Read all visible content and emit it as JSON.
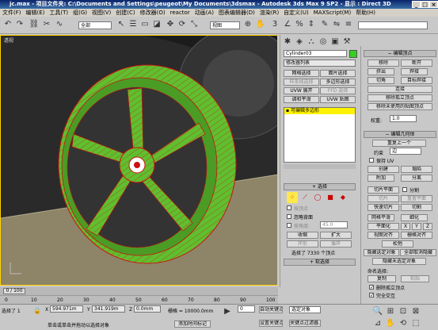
{
  "title": {
    "file": "jc.max",
    "project": "- 项目文件夹: C:\\Documents and Settings\\peugeot\\My Documents\\3dsmax",
    "app": "- Autodesk 3ds Max 9 SP2",
    "display": "- 显示 : Direct 3D"
  },
  "menu": [
    "文件(F)",
    "编辑(E)",
    "工具(T)",
    "组(G)",
    "视图(V)",
    "创建(C)",
    "修改器(O)",
    "reactor",
    "动画(A)",
    "图表编辑器(D)",
    "渲染(R)",
    "自定义(U)",
    "MAXScript(M)",
    "帮助(H)"
  ],
  "toolbar": {
    "selection_filter": "全部",
    "ref_coord": "视图"
  },
  "viewport": {
    "label": "透视",
    "bg_color": "#2a2a2a",
    "object_color": "#5fbf2f",
    "edge_color": "#cc1010"
  },
  "timeline": {
    "frame": "0 / 100",
    "ticks": [
      "0",
      "10",
      "20",
      "30",
      "40",
      "50",
      "60",
      "70",
      "80",
      "90",
      "100"
    ]
  },
  "status": {
    "selected": "选择了 1",
    "x": "594.971m",
    "y": "341.919m",
    "z": "0.0mm",
    "grid": "栅格 = 10000.0mm",
    "prompt": "单击或单击并拖动以选择对象",
    "add_time_tag": "添加时间标记",
    "auto_key": "自动关键点",
    "set_key": "设置关键点",
    "selected_set": "选定对象",
    "key_filters": "关键点过滤器...",
    "frame_value": "0"
  },
  "command_panel": {
    "object_name": "Cylinder03",
    "modifier_list": "修改器列表",
    "buttons": [
      "网格选择",
      "面片选择",
      "样条线选择",
      "多边形选择",
      "UVW 展开",
      "FFD 选择",
      "调和平滑",
      "UVW 贴图"
    ],
    "stack_item": "可编辑多边形",
    "selection_header": "选择",
    "by_vertex": "按顶点",
    "ignore_backfacing": "忽略背面",
    "by_angle": "按角度:",
    "angle_value": "45.0",
    "shrink": "收缩",
    "grow": "扩大",
    "ring": "环形",
    "loop": "循环",
    "selected_count": "选择了 7330 个顶点",
    "soft_selection_header": "软选择"
  },
  "right_panel": {
    "edit_vertices_header": "编辑顶点",
    "remove": "移除",
    "break": "断开",
    "extrude": "挤出",
    "weld": "焊接",
    "chamfer": "切角",
    "target_weld": "目标焊接",
    "connect": "连接",
    "remove_isolated": "移除孤立顶点",
    "remove_unused_map": "移除未使用的贴图顶点",
    "weight_label": "权重:",
    "weight_value": "1.0",
    "edit_geometry_header": "编辑几何体",
    "repeat_last": "重复上一个",
    "constraints_label": "约束",
    "constraints_value": "边",
    "preserve_uv": "保持 UV",
    "create": "创建",
    "collapse": "塌陷",
    "attach": "附加",
    "detach": "分离",
    "slice_plane": "切片平面",
    "split": "分割",
    "slice": "切片",
    "reset_plane": "重置平面",
    "quickslice": "快速切片",
    "cut": "切割",
    "meshsmooth": "网格平滑",
    "tessellate": "细化",
    "planarize": "平面化",
    "x": "X",
    "y": "Y",
    "z": "Z",
    "view_align": "视图对齐",
    "grid_align": "栅格对齐",
    "relax": "松弛",
    "hide_selected": "隐藏选定对象",
    "unhide_all": "全部取消隐藏",
    "hide_unselected": "隐藏未选定对象",
    "named_selections": "命名选择:",
    "copy": "复制",
    "paste": "粘贴",
    "delete_isolated": "删除孤立顶点",
    "full_interactivity": "完全交互"
  }
}
